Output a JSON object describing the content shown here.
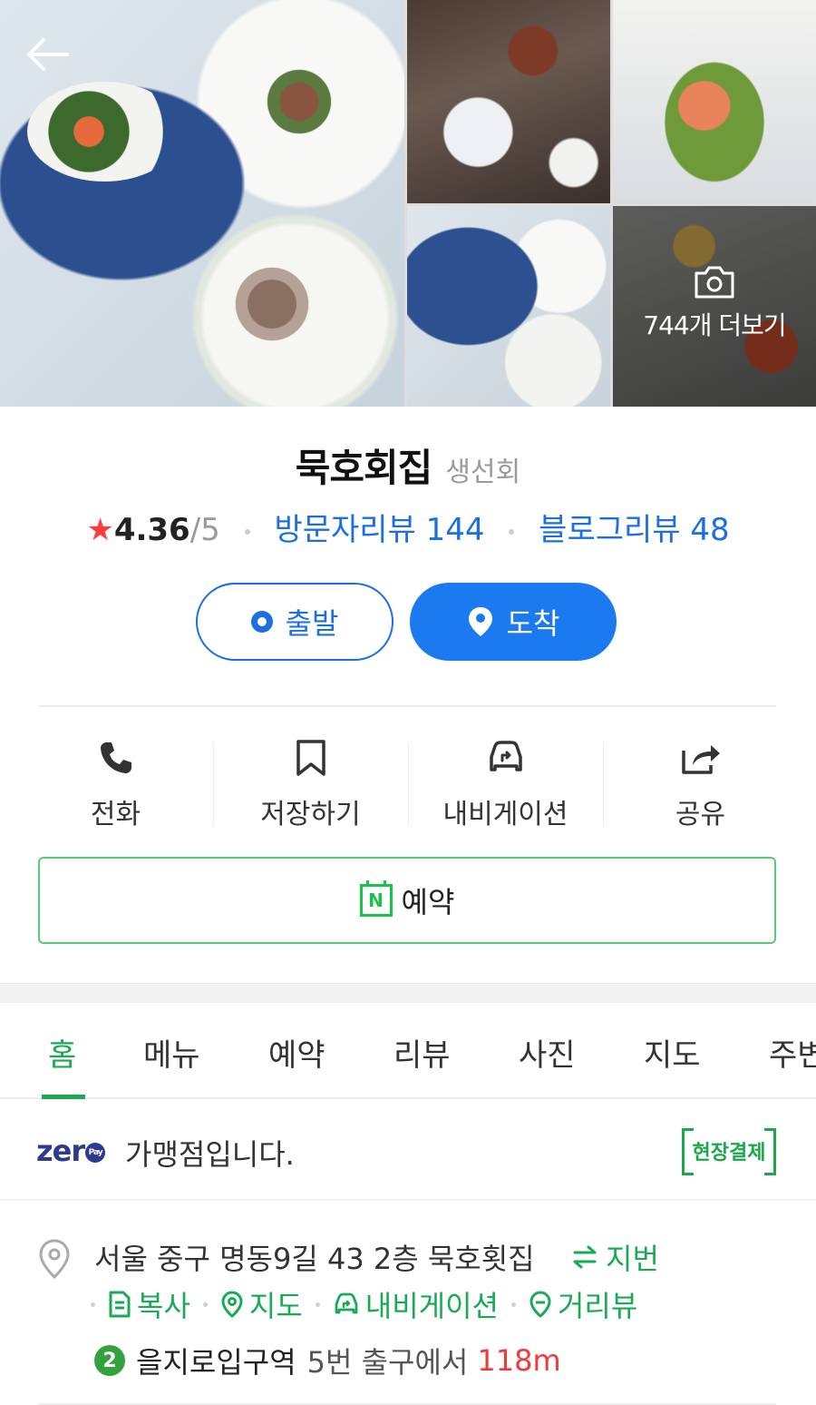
{
  "gallery": {
    "more_label": "744개 더보기"
  },
  "place": {
    "name": "묵호회집",
    "category": "생선회",
    "rating_star": "★",
    "rating": "4.36",
    "rating_max": "/5",
    "visitor_review_label": "방문자리뷰 144",
    "blog_review_label": "블로그리뷰 48"
  },
  "route": {
    "depart_label": "출발",
    "arrive_label": "도착"
  },
  "actions": [
    {
      "icon": "phone-icon",
      "label": "전화"
    },
    {
      "icon": "bookmark-icon",
      "label": "저장하기"
    },
    {
      "icon": "car-navigation-icon",
      "label": "내비게이션"
    },
    {
      "icon": "share-icon",
      "label": "공유"
    }
  ],
  "reserve": {
    "icon_text": "N",
    "label": "예약"
  },
  "tabs": [
    {
      "label": "홈",
      "active": true
    },
    {
      "label": "메뉴"
    },
    {
      "label": "예약"
    },
    {
      "label": "리뷰"
    },
    {
      "label": "사진"
    },
    {
      "label": "지도"
    },
    {
      "label": "주변"
    }
  ],
  "zeropay": {
    "logo_text": "zer",
    "logo_badge": "Pay",
    "text": "가맹점입니다.",
    "badge": "현장결제"
  },
  "address": {
    "text": "서울 중구 명동9길 43 2층 묵호횟집",
    "jibun_label": "지번",
    "copy_label": "복사",
    "map_label": "지도",
    "nav_label": "내비게이션",
    "roadview_label": "거리뷰",
    "subway_line": "2",
    "station": "을지로입구역",
    "exit": "5번 출구에서",
    "distance": "118m"
  },
  "colors": {
    "accent_blue": "#1c6fe0",
    "naver_green": "#1aa955",
    "star_red": "#ff3b3b",
    "subway_line2": "#33a23d"
  }
}
